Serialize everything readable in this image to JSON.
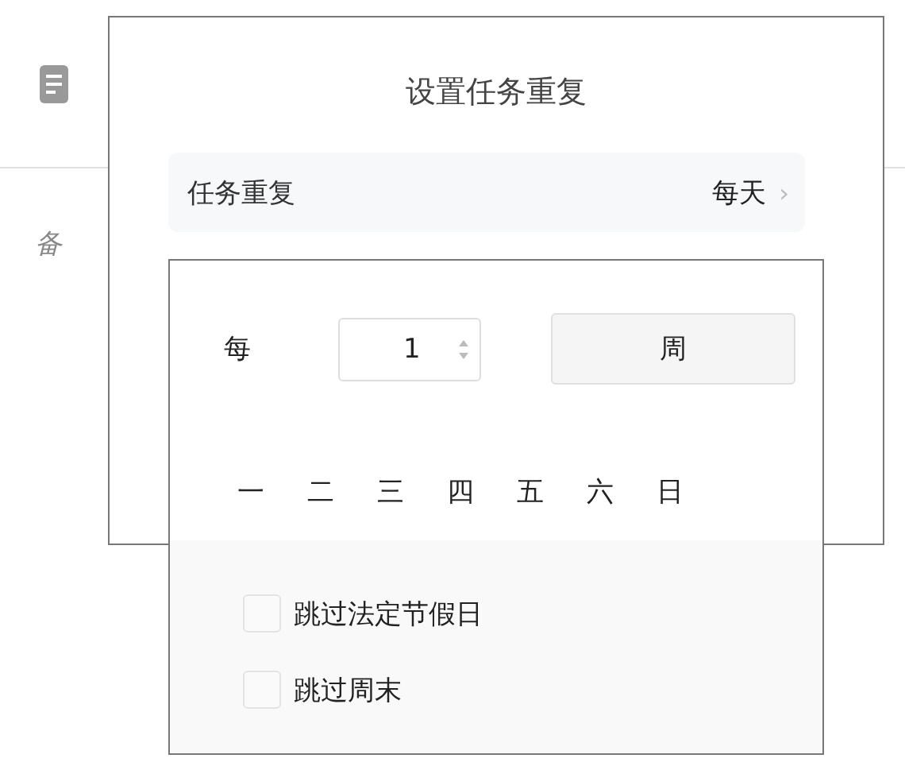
{
  "background": {
    "note_label": "备"
  },
  "dialog": {
    "title": "设置任务重复",
    "repeat_row": {
      "label": "任务重复",
      "value": "每天",
      "chevron": "›"
    }
  },
  "popup": {
    "every_label": "每",
    "interval": "1",
    "unit": "周",
    "weekdays": [
      {
        "label": "一",
        "selected": false
      },
      {
        "label": "二",
        "selected": false
      },
      {
        "label": "三",
        "selected": false
      },
      {
        "label": "四",
        "selected": false
      },
      {
        "label": "五",
        "selected": false
      },
      {
        "label": "六",
        "selected": false
      },
      {
        "label": "日",
        "selected": false
      }
    ],
    "options": [
      {
        "label": "跳过法定节假日",
        "checked": false
      },
      {
        "label": "跳过周末",
        "checked": false
      }
    ]
  }
}
